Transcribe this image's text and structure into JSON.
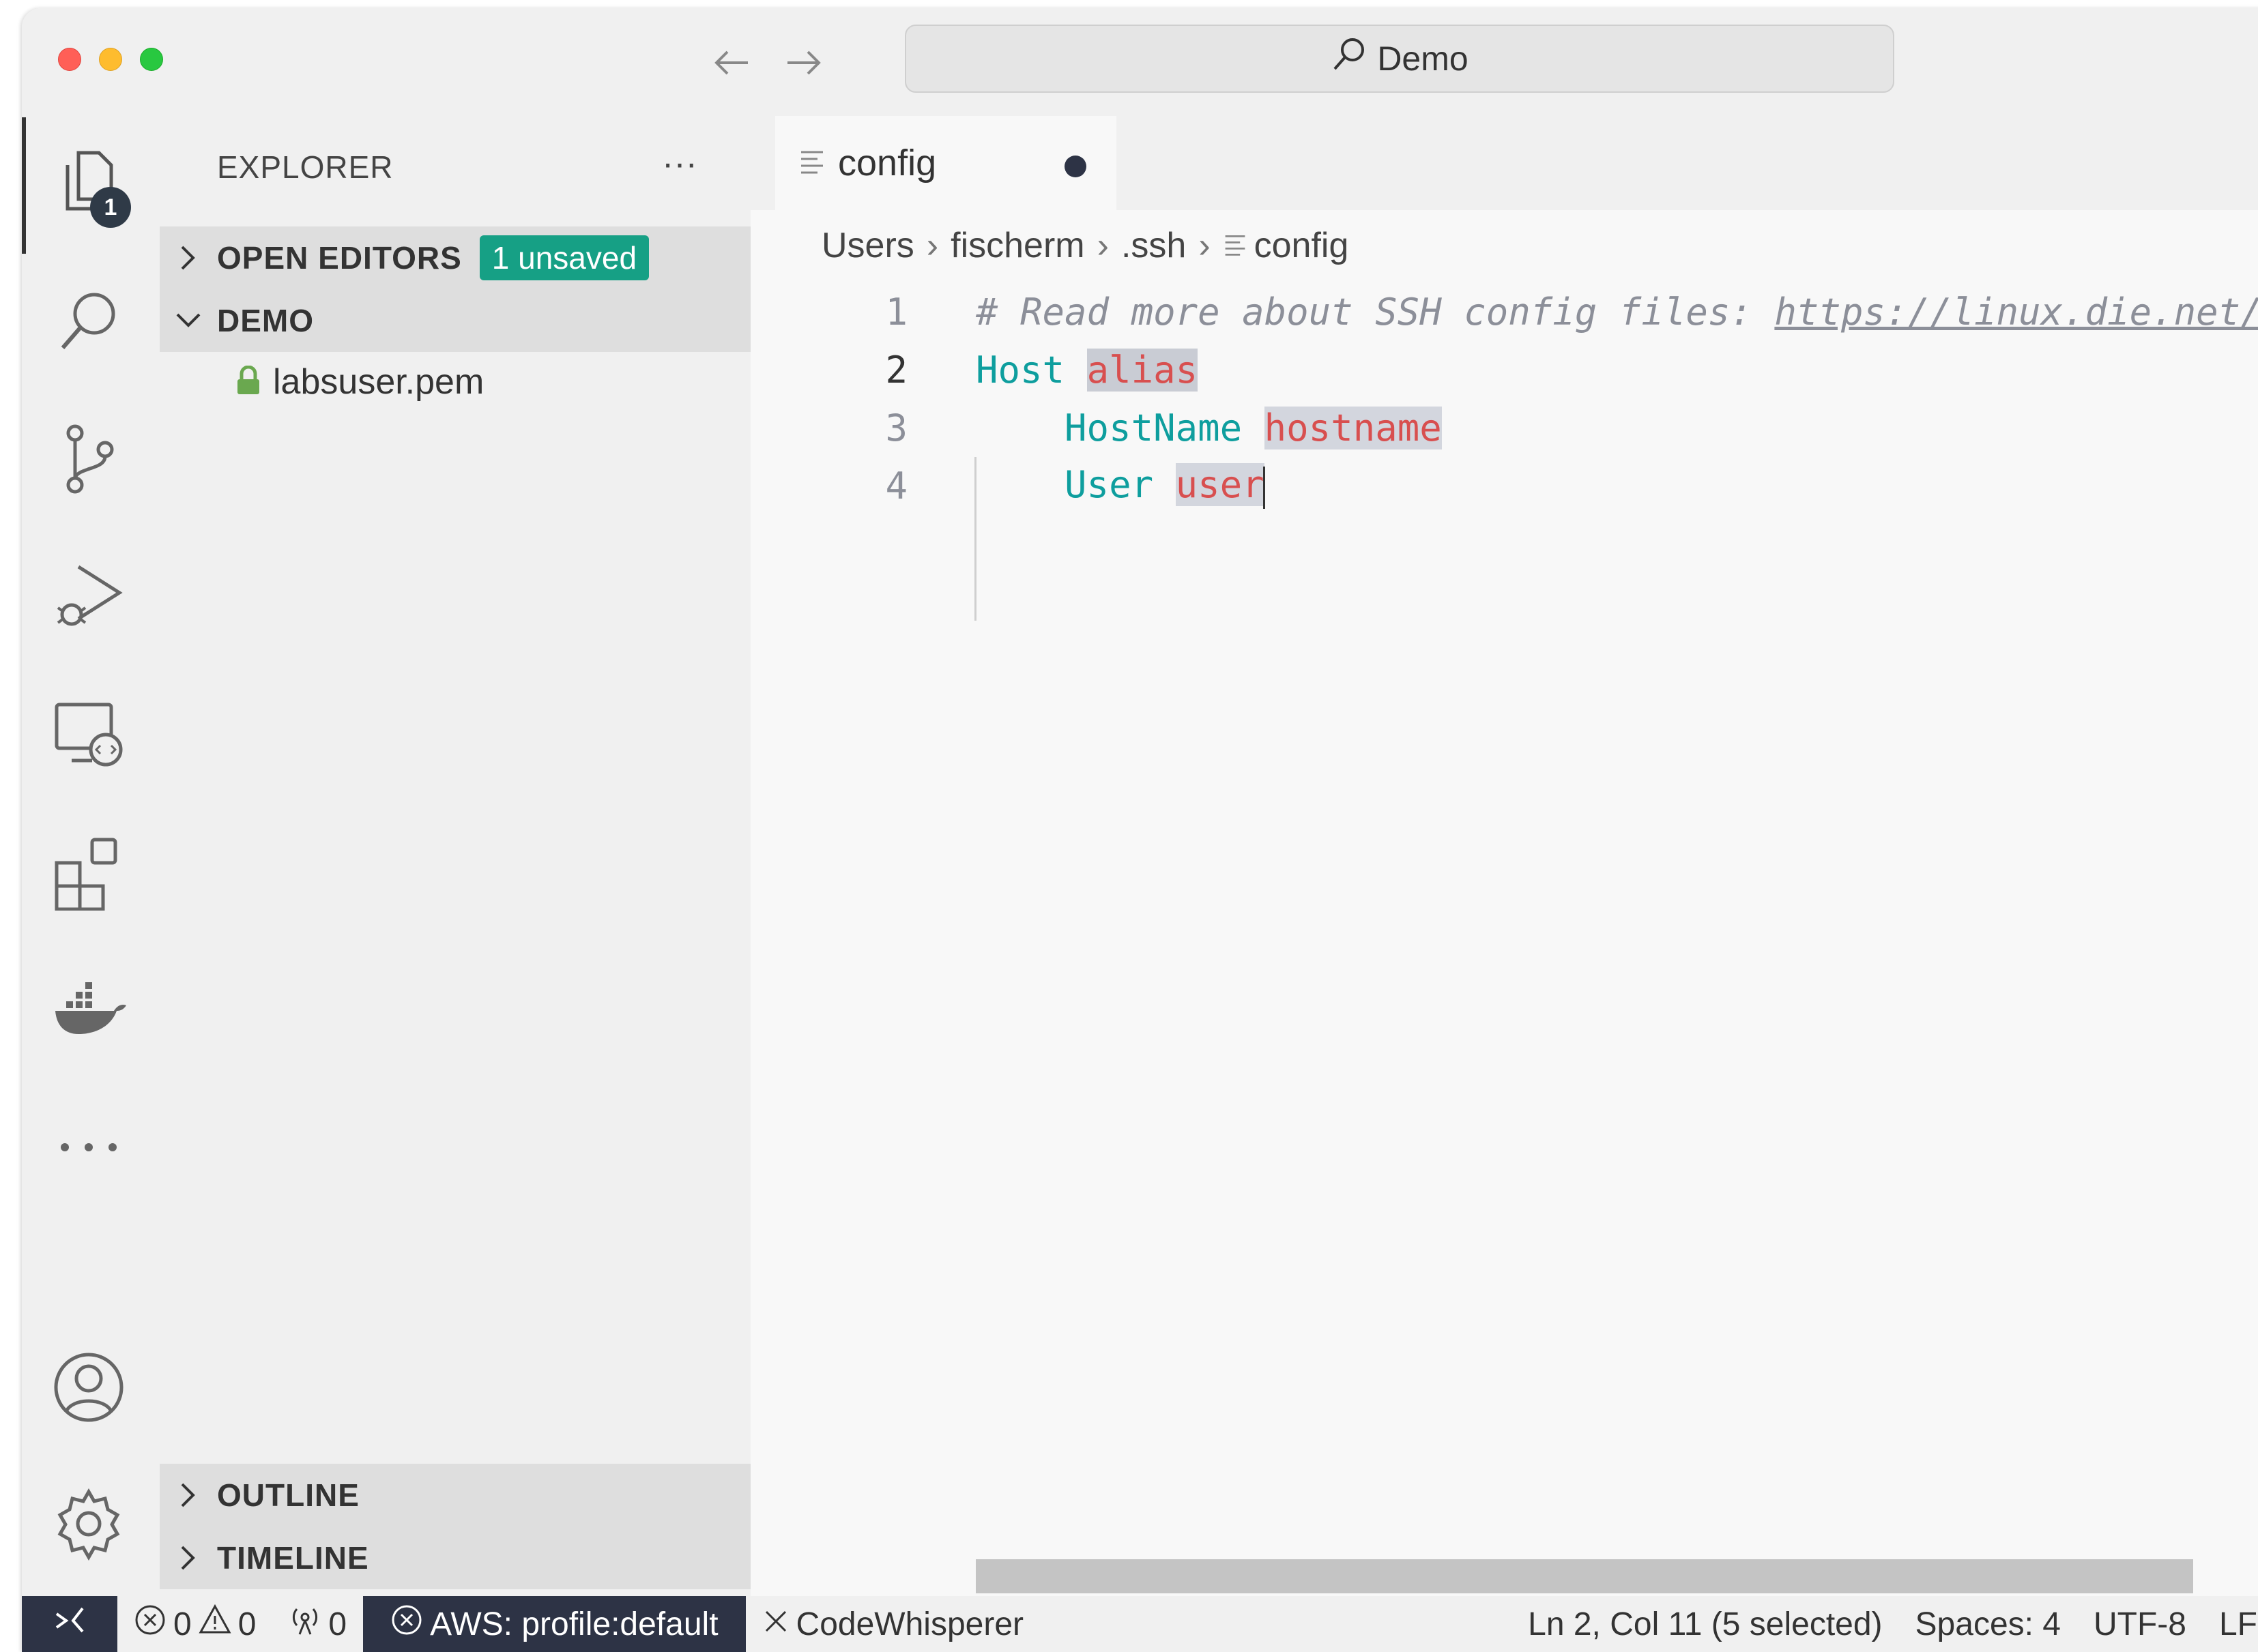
{
  "titlebar": {
    "search_text": "Demo"
  },
  "activity": {
    "explorer_badge": "1"
  },
  "sidebar": {
    "title": "EXPLORER",
    "open_editors": {
      "label": "OPEN EDITORS",
      "badge": "1 unsaved"
    },
    "folder": {
      "label": "DEMO"
    },
    "files": [
      {
        "name": "labsuser.pem"
      }
    ],
    "outline": "OUTLINE",
    "timeline": "TIMELINE"
  },
  "editor": {
    "tab": {
      "label": "config"
    },
    "breadcrumb": [
      "Users",
      "fischerm",
      ".ssh",
      "config"
    ],
    "lines": [
      {
        "number": "1",
        "comment": "# Read more about SSH config files: ",
        "link": "https://linux.die.net/"
      },
      {
        "number": "2",
        "keyword": "Host",
        "value": "alias"
      },
      {
        "number": "3",
        "indent": "    ",
        "keyword": "HostName",
        "value": "hostname"
      },
      {
        "number": "4",
        "indent": "    ",
        "keyword": "User",
        "value": "user"
      }
    ]
  },
  "statusbar": {
    "errors": "0",
    "warnings": "0",
    "ports": "0",
    "aws": "AWS: profile:default",
    "codewhisperer": "CodeWhisperer",
    "position": "Ln 2, Col 11 (5 selected)",
    "spaces": "Spaces: 4",
    "encoding": "UTF-8",
    "eol": "LF"
  },
  "colors": {
    "accent_teal": "#16a085",
    "keyword": "#0e9e9e",
    "value": "#d84f4f",
    "status_dark": "#2d3345"
  }
}
